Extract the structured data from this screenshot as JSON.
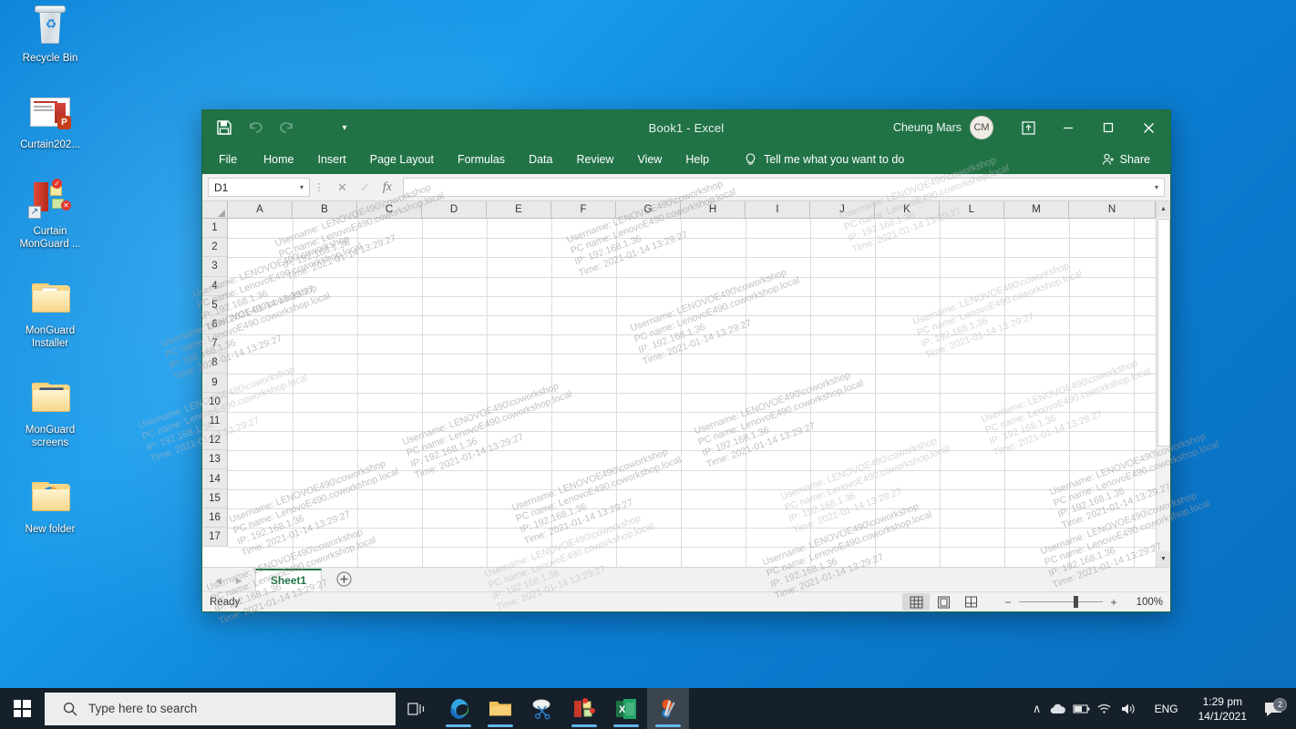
{
  "desktop": {
    "icons": [
      {
        "label": "Recycle Bin",
        "type": "recycle-bin"
      },
      {
        "label": "Curtain202...",
        "type": "powerpoint-file"
      },
      {
        "label": "Curtain MonGuard ...",
        "type": "app-shortcut"
      },
      {
        "label": "MonGuard Installer",
        "type": "folder"
      },
      {
        "label": "MonGuard screens",
        "type": "folder"
      },
      {
        "label": "New folder",
        "type": "folder"
      }
    ]
  },
  "excel": {
    "title": "Book1  -  Excel",
    "quick_access": {
      "save": "save-icon",
      "undo": "undo-icon",
      "redo": "redo-icon",
      "customize": "chevron-down-icon"
    },
    "account_name": "Cheung Mars",
    "account_initials": "CM",
    "window_controls": {
      "ribbon_options": "ribbon-display-options",
      "minimize": "—",
      "maximize": "❐",
      "close": "✕"
    },
    "tabs": [
      "File",
      "Home",
      "Insert",
      "Page Layout",
      "Formulas",
      "Data",
      "Review",
      "View",
      "Help"
    ],
    "tell_me": "Tell me what you want to do",
    "share_label": "Share",
    "name_box_value": "D1",
    "formula_bar_value": "",
    "columns": [
      "A",
      "B",
      "C",
      "D",
      "E",
      "F",
      "G",
      "H",
      "I",
      "J",
      "K",
      "L",
      "M",
      "N"
    ],
    "rows": [
      1,
      2,
      3,
      4,
      5,
      6,
      7,
      8,
      9,
      10,
      11,
      12,
      13,
      14,
      15,
      16,
      17
    ],
    "sheet_tab": "Sheet1",
    "add_sheet": "+",
    "status": "Ready",
    "view_buttons": [
      "normal-view",
      "page-layout-view",
      "page-break-preview"
    ],
    "zoom_level": "100%",
    "accent_color": "#217346"
  },
  "watermark": {
    "line1": "Username: LENOVOE490\\coworkshop",
    "line2": "PC name: LenovoE490.coworkshop.local",
    "line3": "IP: 192.168.1.36",
    "line4": "Time: 2021-01-14 13:29:27"
  },
  "taskbar": {
    "start": "windows-logo",
    "search_placeholder": "Type here to search",
    "items": [
      {
        "name": "task-view"
      },
      {
        "name": "microsoft-edge"
      },
      {
        "name": "file-explorer"
      },
      {
        "name": "snipping-tool"
      },
      {
        "name": "curtain-monguard"
      },
      {
        "name": "microsoft-excel"
      },
      {
        "name": "snip-and-sketch"
      }
    ],
    "tray": {
      "show_hidden": "∧",
      "onedrive": "cloud-icon",
      "battery": "battery-icon",
      "network": "wifi-icon",
      "volume": "speaker-icon",
      "language": "ENG",
      "time": "1:29 pm",
      "date": "14/1/2021",
      "notifications_count": "2"
    }
  }
}
